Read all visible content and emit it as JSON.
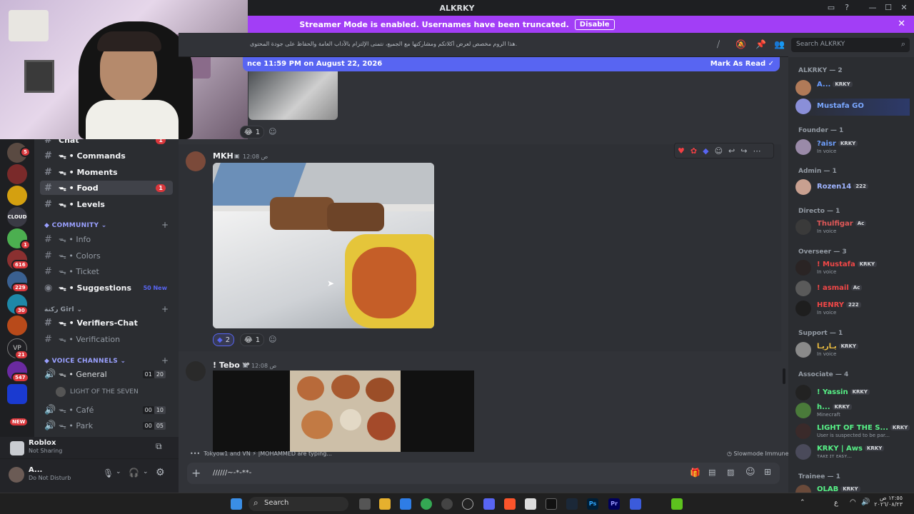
{
  "window": {
    "title": "ALKRKY"
  },
  "banner": {
    "text": "Streamer Mode is enabled. Usernames have been truncated.",
    "disable_label": "Disable"
  },
  "server_badges": [
    "5",
    "1",
    "616",
    "229",
    "30",
    "21",
    "547",
    "NEW"
  ],
  "channels": {
    "items": [
      {
        "label": "Chat"
      },
      {
        "label": "ᯓ • Commands"
      },
      {
        "label": "ᯓ • Moments"
      },
      {
        "label": "ᯓ • Food",
        "badge": "1"
      },
      {
        "label": "ᯓ • Levels"
      }
    ],
    "community_category": "COMMUNITY",
    "community": [
      {
        "label": "ᯓ • Info"
      },
      {
        "label": "ᯓ • Colors"
      },
      {
        "label": "ᯓ • Ticket"
      },
      {
        "label": "ᯓ • Suggestions",
        "badge": "50 New"
      }
    ],
    "girl_category": "ركنة Girl",
    "girl": [
      {
        "label": "ᯓ • Verifiers-Chat"
      },
      {
        "label": "ᯓ • Verification"
      }
    ],
    "voice_category": "VOICE CHANNELS",
    "voice": [
      {
        "label": "ᯓ • General",
        "a": "01",
        "b": "20"
      },
      {
        "label": "ᯓ • Café",
        "a": "00",
        "b": "10"
      },
      {
        "label": "ᯓ • Park",
        "a": "00",
        "b": "05"
      }
    ],
    "voice_member": "LIGHT OF THE SEVEN"
  },
  "activity": {
    "title": "Roblox",
    "status": "Not Sharing"
  },
  "user": {
    "name": "A...",
    "status": "Do Not Disturb"
  },
  "header": {
    "topic": ".هذا الروم مخصص لعرض أكلاتكم ومشاركتها مع الجميع، نتمنى الإلتزام بالآداب العامة والحفاظ على جودة المحتوى",
    "search_placeholder": "Search ALKRKY"
  },
  "newbar": {
    "text": "nce 11:59 PM on August 22, 2026",
    "mark": "Mark As Read"
  },
  "messages": [
    {
      "author": "MKH",
      "time": "12:08 ص",
      "reactions": [
        {
          "emoji": "💎",
          "count": "2"
        },
        {
          "emoji": "😂",
          "count": "1"
        }
      ]
    },
    {
      "author": "! Tebo ᵞᵒ",
      "time": "12:08 ص"
    }
  ],
  "top_reaction_count": "1",
  "typing": {
    "text": "Tokyow1 and VN ⚡ |MOHAMMED are typing...",
    "slowmode": "Slowmode Immune"
  },
  "composer": {
    "value": "//////~-*-**-"
  },
  "members": {
    "groups": [
      {
        "title": "ALKRKY — 2"
      },
      {
        "title": "Founder — 1"
      },
      {
        "title": "Admin — 1"
      },
      {
        "title": "Directo — 1"
      },
      {
        "title": "Overseer — 3"
      },
      {
        "title": "Support — 1"
      },
      {
        "title": "Associate — 4"
      },
      {
        "title": "Trainee — 1"
      }
    ],
    "list": [
      {
        "name": "A...",
        "tag": "KRKY",
        "color": "#5d9bff"
      },
      {
        "name": "Mustafa GO",
        "color": "#7aa7ff"
      },
      {
        "name": "?aisr",
        "tag": "KRKY",
        "sub": "In voice",
        "color": "#6fa0ff"
      },
      {
        "name": "Rozen14",
        "tag": "222",
        "color": "#9fb4ff"
      },
      {
        "name": "Thulfigar",
        "tag": "Ac",
        "sub": "In voice",
        "color": "#e05858"
      },
      {
        "name": "! Mustafa",
        "tag": "KRKY",
        "sub": "In voice",
        "color": "#f04747"
      },
      {
        "name": "! asmail",
        "tag": "Ac",
        "color": "#f04747"
      },
      {
        "name": "HENRY",
        "tag": "222",
        "sub": "In voice",
        "color": "#f04747"
      },
      {
        "name": "يـاريـا",
        "tag": "KRKY",
        "sub": "In voice",
        "color": "#f0c040"
      },
      {
        "name": "! Yassin",
        "tag": "KRKY",
        "color": "#57f287"
      },
      {
        "name": "h...",
        "tag": "KRKY",
        "sub": "Minecraft",
        "color": "#57f287"
      },
      {
        "name": "LIGHT OF THE S...",
        "tag": "KRKY",
        "sub": "User is suspected to be par...",
        "color": "#57f287"
      },
      {
        "name": "KRKY | Aws",
        "tag": "KRKY",
        "sub": "ᴛᴀᴋᴇ ɪᴛ ᴇᴀꜱʏ...",
        "color": "#57f287"
      },
      {
        "name": "OLAB",
        "tag": "KRKY",
        "color": "#57f287"
      }
    ]
  },
  "taskbar": {
    "search": "Search",
    "time": "١٢:٥٥ ص",
    "date": "٢٠٢٦/٠٨/٢٣",
    "lang": "ع"
  }
}
